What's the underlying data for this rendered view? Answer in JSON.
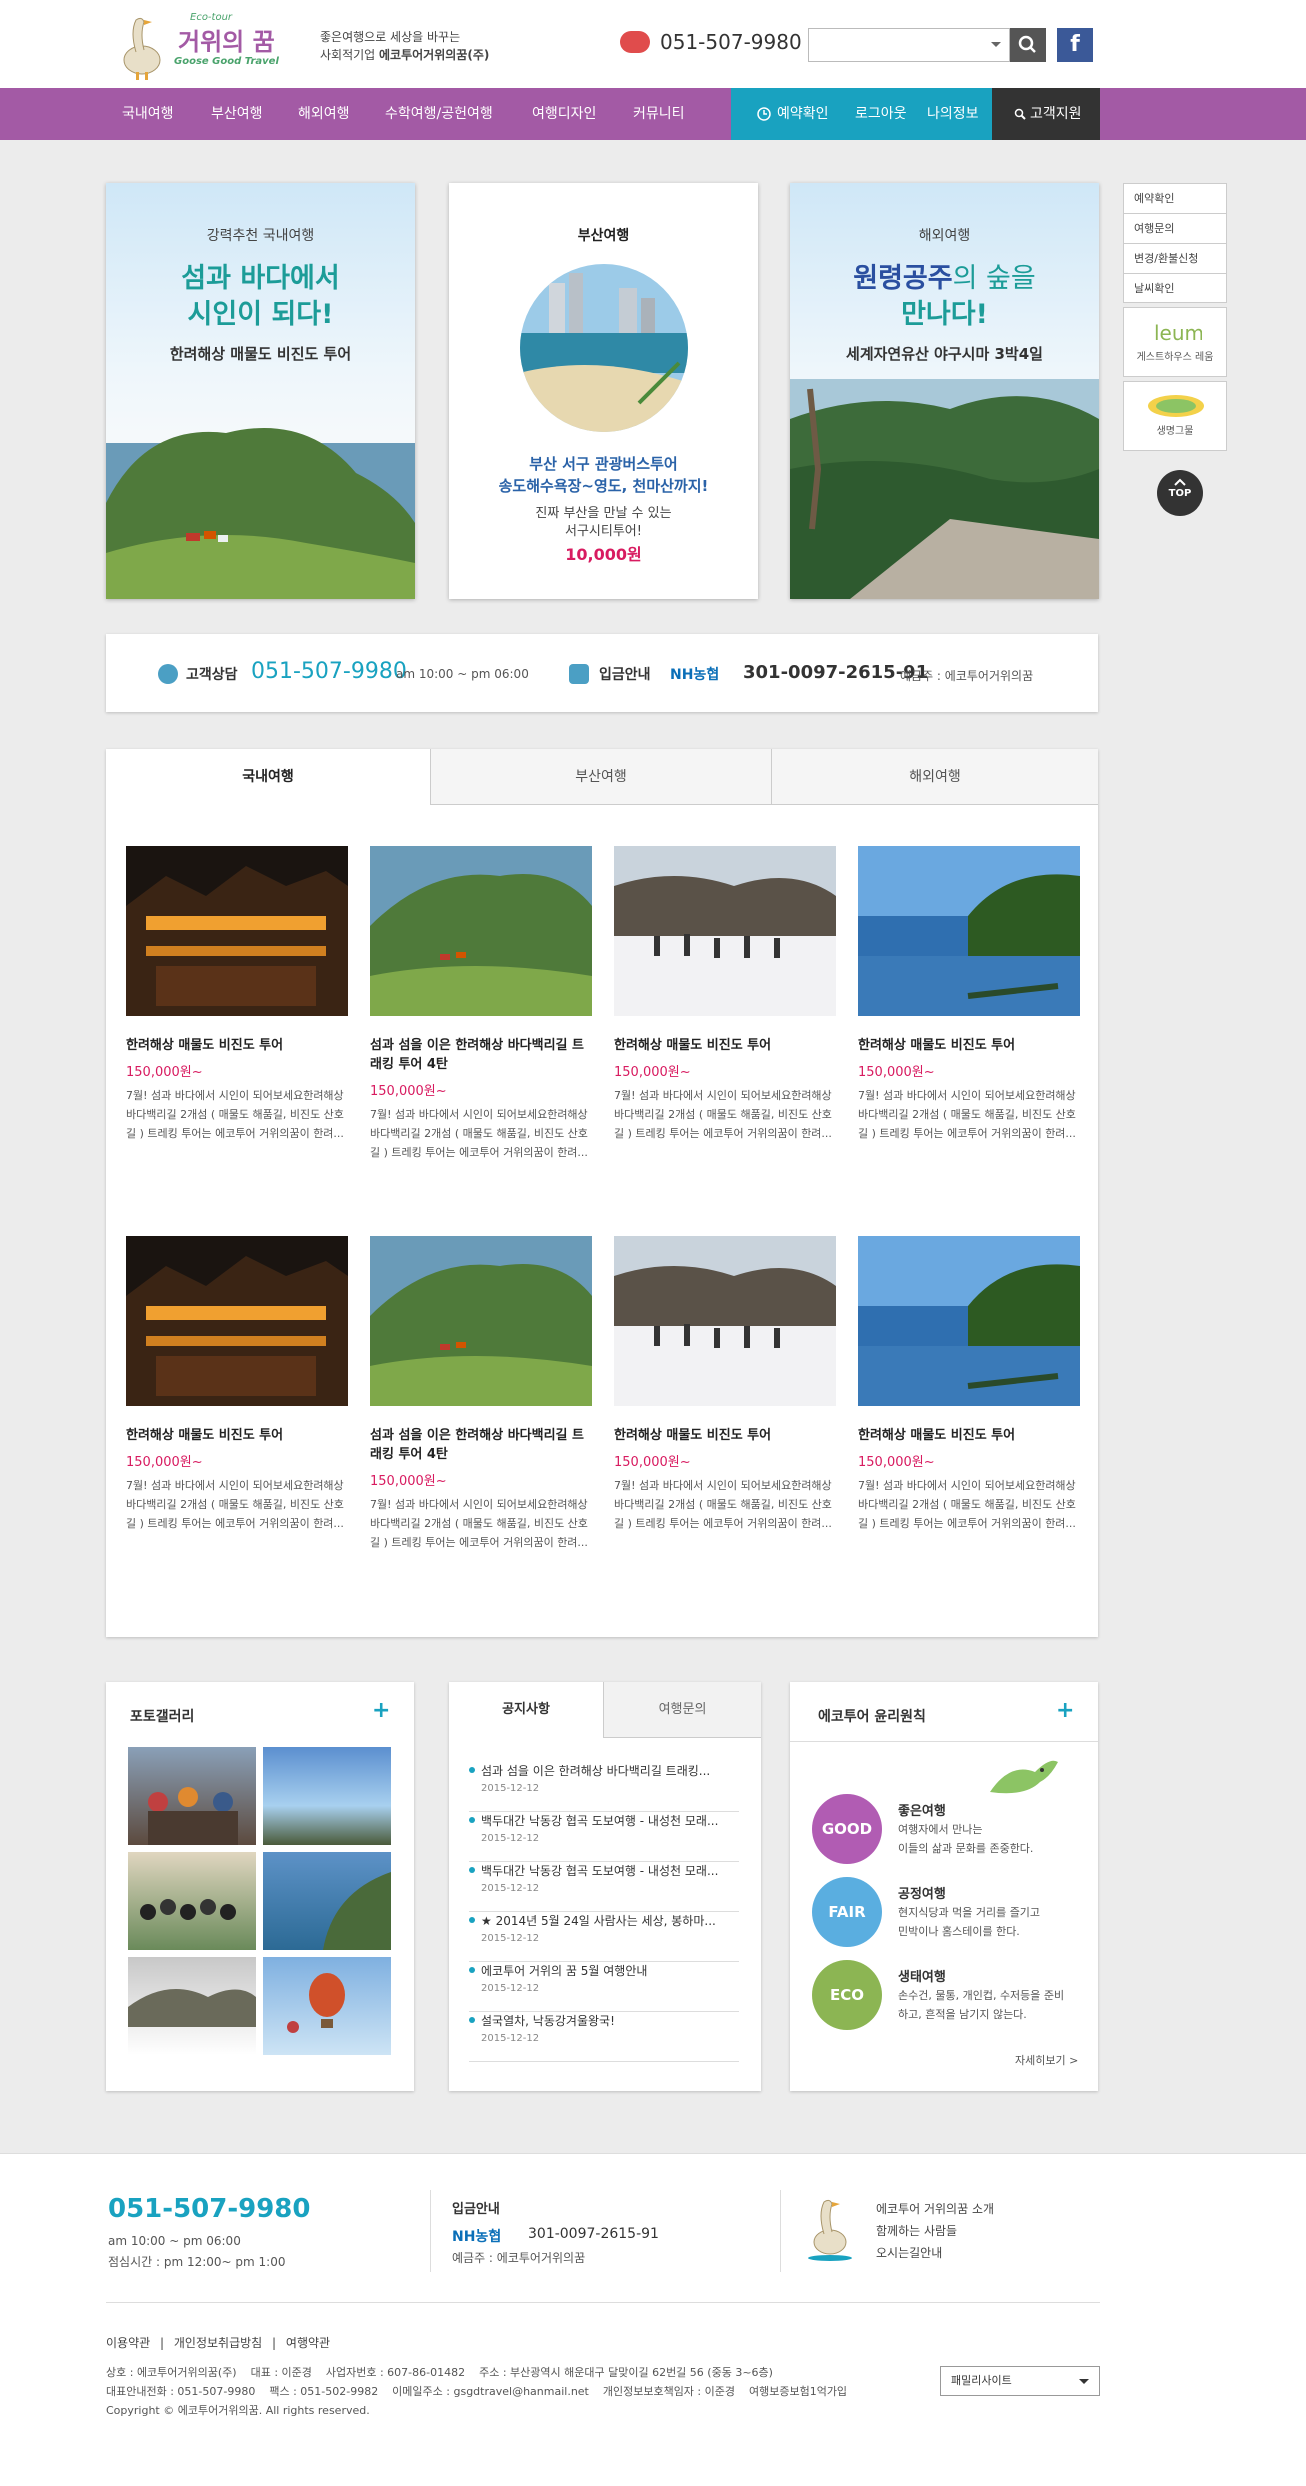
{
  "header": {
    "logo_small": "Eco-tour",
    "logo_main": "거위의 꿈",
    "logo_sub": "Goose Good Travel",
    "slogan_line1": "좋은여행으로 세상을 바꾸는",
    "slogan_line2_prefix": "사회적기업 ",
    "slogan_line2_bold": "에코투어거위의꿈(주)",
    "phone": "051-507-9980",
    "search": {
      "value": "",
      "placeholder": ""
    }
  },
  "nav": {
    "items": [
      "국내여행",
      "부산여행",
      "해외여행",
      "수학여행/공헌여행",
      "여행디자인",
      "커뮤니티"
    ],
    "reservation": "예약확인",
    "logout": "로그아웃",
    "myinfo": "나의정보",
    "support": "고객지원"
  },
  "banners": [
    {
      "sub": "강력추천 국내여행",
      "head1": "섬과 바다에서",
      "head2": "시인이 되다!",
      "desc": "한려해상 매물도 비진도 투어"
    },
    {
      "sub": "부산여행",
      "line1": "부산 서구 관광버스투어",
      "line2": "송도해수욕장~영도, 천마산까지!",
      "line3": "진짜 부산을 만날 수 있는",
      "line4": "서구시티투어!",
      "price": "10,000원"
    },
    {
      "sub": "해외여행",
      "head1a": "원령공주",
      "head1b": "의 숲을",
      "head2": "만나다!",
      "desc": "세계자연유산 야구시마 3박4일"
    }
  ],
  "quick_menu": {
    "items": [
      "예약확인",
      "여행문의",
      "변경/환불신청",
      "날씨확인"
    ],
    "logo1_label": "게스트하우스 레움",
    "logo2_label": "생명그물",
    "top": "TOP"
  },
  "info_bar": {
    "consult_label": "고객상담",
    "phone": "051-507-9980",
    "hours": "am 10:00 ~ pm 06:00",
    "deposit_label": "입금안내",
    "bank": "NH농협",
    "account": "301-0097-2615-91",
    "holder": "예금주 : 에코투어거위의꿈"
  },
  "tabs": {
    "labels": [
      "국내여행",
      "부산여행",
      "해외여행"
    ],
    "active": "국내여행",
    "cards": [
      {
        "title": "한려해상 매물도 비진도 투어",
        "price": "150,000원~",
        "desc": "7월! 섬과 바다에서 시인이 되어보세요한려해상 바다백리길 2개섬 ( 매물도 해품길, 비진도 산호길 ) 트레킹 투어는 에코투어 거위의꿈이 한려..."
      },
      {
        "title": "섬과 섬을 이은 한려해상 바다백리길 트래킹 투어 4탄",
        "price": "150,000원~",
        "desc": "7월! 섬과 바다에서 시인이 되어보세요한려해상 바다백리길 2개섬 ( 매물도 해품길, 비진도 산호길 ) 트레킹 투어는 에코투어 거위의꿈이 한려..."
      },
      {
        "title": "한려해상 매물도 비진도 투어",
        "price": "150,000원~",
        "desc": "7월! 섬과 바다에서 시인이 되어보세요한려해상 바다백리길 2개섬 ( 매물도 해품길, 비진도 산호길 ) 트레킹 투어는 에코투어 거위의꿈이 한려..."
      },
      {
        "title": "한려해상 매물도 비진도 투어",
        "price": "150,000원~",
        "desc": "7월! 섬과 바다에서 시인이 되어보세요한려해상 바다백리길 2개섬 ( 매물도 해품길, 비진도 산호길 ) 트레킹 투어는 에코투어 거위의꿈이 한려..."
      },
      {
        "title": "한려해상 매물도 비진도 투어",
        "price": "150,000원~",
        "desc": "7월! 섬과 바다에서 시인이 되어보세요한려해상 바다백리길 2개섬 ( 매물도 해품길, 비진도 산호길 ) 트레킹 투어는 에코투어 거위의꿈이 한려..."
      },
      {
        "title": "섬과 섬을 이은 한려해상 바다백리길 트래킹 투어 4탄",
        "price": "150,000원~",
        "desc": "7월! 섬과 바다에서 시인이 되어보세요한려해상 바다백리길 2개섬 ( 매물도 해품길, 비진도 산호길 ) 트레킹 투어는 에코투어 거위의꿈이 한려..."
      },
      {
        "title": "한려해상 매물도 비진도 투어",
        "price": "150,000원~",
        "desc": "7월! 섬과 바다에서 시인이 되어보세요한려해상 바다백리길 2개섬 ( 매물도 해품길, 비진도 산호길 ) 트레킹 투어는 에코투어 거위의꿈이 한려..."
      },
      {
        "title": "한려해상 매물도 비진도 투어",
        "price": "150,000원~",
        "desc": "7월! 섬과 바다에서 시인이 되어보세요한려해상 바다백리길 2개섬 ( 매물도 해품길, 비진도 산호길 ) 트레킹 투어는 에코투어 거위의꿈이 한려..."
      }
    ]
  },
  "gallery": {
    "title": "포토갤러리",
    "more": "+"
  },
  "notice": {
    "tabs": [
      "공지사항",
      "여행문의"
    ],
    "items": [
      {
        "text": "섬과 섬을 이은 한려해상 바다백리길 트래킹...",
        "date": "2015-12-12"
      },
      {
        "text": "백두대간 낙동강 협곡 도보여행 - 내성천 모래...",
        "date": "2015-12-12"
      },
      {
        "text": "백두대간 낙동강 협곡 도보여행 - 내성천 모래...",
        "date": "2015-12-12"
      },
      {
        "text": "★ 2014년 5월 24일 사람사는 세상, 봉하마...",
        "date": "2015-12-12"
      },
      {
        "text": "에코투어 거위의 꿈 5월 여행안내",
        "date": "2015-12-12"
      },
      {
        "text": "설국열차, 낙동강겨울왕국!",
        "date": "2015-12-12"
      }
    ]
  },
  "ethics": {
    "title": "에코투어 윤리원칙",
    "more_plus": "+",
    "items": [
      {
        "badge": "GOOD",
        "color": "#b15cb3",
        "title": "좋은여행",
        "line1": "여행자에서 만나는",
        "line2": "이들의 삶과 문화를 존중한다."
      },
      {
        "badge": "FAIR",
        "color": "#5aaee0",
        "title": "공정여행",
        "line1": "현지식당과 먹을 거리를 즐기고",
        "line2": "민박이나 홈스테이를 한다."
      },
      {
        "badge": "ECO",
        "color": "#8cb553",
        "title": "생태여행",
        "line1": "손수건, 물통, 개인컵, 수저등을 준비",
        "line2": "하고, 흔적을 남기지 않는다."
      }
    ],
    "more": "자세히보기 >"
  },
  "footer": {
    "phone": "051-507-9980",
    "hours1": "am 10:00 ~ pm 06:00",
    "hours2": "점심시간 : pm 12:00~ pm 1:00",
    "deposit_label": "입금안내",
    "bank": "NH농협",
    "account": "301-0097-2615-91",
    "holder": "예금주 : 에코투어거위의꿈",
    "links_right": [
      "에코투어 거위의꿈 소개",
      "함께하는 사람들",
      "오시는길안내"
    ],
    "links": [
      "이용약관",
      "개인정보취급방침",
      "여행약관"
    ],
    "info1": "상호 : 에코투어거위의꿈(주)    대표 : 이준경    사업자번호 : 607-86-01482    주소 : 부산광역시 해운대구 달맞이길 62번길 56 (중동 3~6층)",
    "info2": "대표안내전화 : 051-507-9980    팩스 : 051-502-9982    이메일주소 : gsgdtravel@hanmail.net    개인정보보호책임자 : 이준경    여행보증보험1억가입",
    "copyright": "Copyright © 에코투어거위의꿈. All rights reserved.",
    "family_site": "패밀리사이트"
  },
  "colors": {
    "purple": "#a35aa5",
    "teal": "#19a2c0",
    "price": "#d81b60",
    "dark": "#333333"
  }
}
